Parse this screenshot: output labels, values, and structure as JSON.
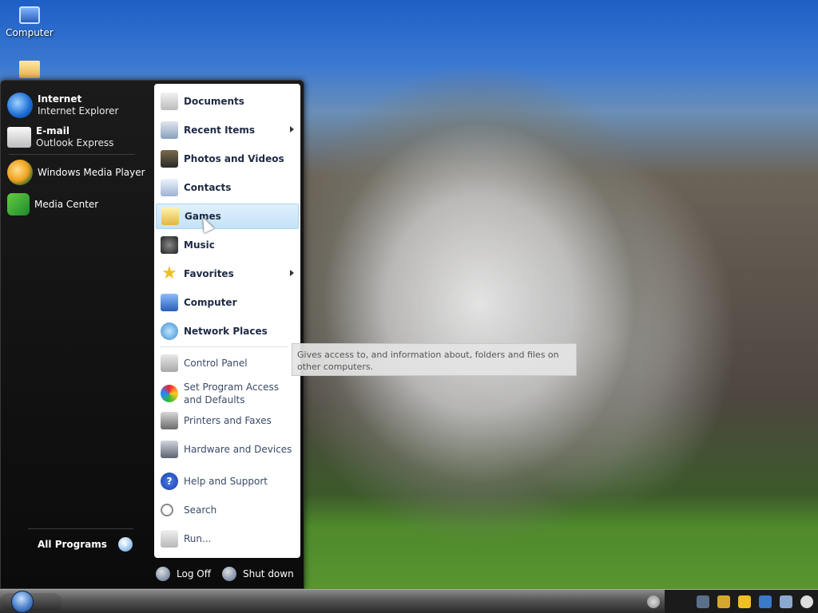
{
  "desktop": {
    "icons": [
      {
        "label": "Computer"
      }
    ]
  },
  "start_menu": {
    "pinned": [
      {
        "title": "Internet",
        "subtitle": "Internet Explorer"
      },
      {
        "title": "E-mail",
        "subtitle": "Outlook Express"
      }
    ],
    "recent": [
      {
        "label": "Windows Media Player"
      },
      {
        "label": "Media Center"
      }
    ],
    "all_programs": "All Programs",
    "right": [
      {
        "label": "Documents",
        "submenu": false
      },
      {
        "label": "Recent Items",
        "submenu": true
      },
      {
        "label": "Photos and Videos",
        "submenu": false
      },
      {
        "label": "Contacts",
        "submenu": false
      },
      {
        "label": "Games",
        "submenu": false,
        "hovered": true
      },
      {
        "label": "Music",
        "submenu": false
      },
      {
        "label": "Favorites",
        "submenu": true
      },
      {
        "label": "Computer",
        "submenu": false
      },
      {
        "label": "Network Places",
        "submenu": false
      }
    ],
    "right_lower": [
      {
        "label": "Control Panel"
      },
      {
        "label": "Set Program Access and Defaults"
      },
      {
        "label": "Printers and Faxes"
      },
      {
        "label": "Hardware and Devices"
      },
      {
        "label": "Help and Support"
      },
      {
        "label": "Search"
      },
      {
        "label": "Run..."
      }
    ],
    "footer": {
      "logoff": "Log Off",
      "shutdown": "Shut down"
    }
  },
  "tooltip": {
    "text": "Gives access to, and information about, folders and files on other computers."
  },
  "taskbar": {
    "tray_icons": [
      "search-icon",
      "bell-icon",
      "lightning-icon",
      "network-icon",
      "window-icon",
      "clock-icon"
    ]
  },
  "colors": {
    "menu_bg": "#0b0b0b",
    "right_pane_bg": "#ffffff",
    "hover": "#c4e2f7"
  }
}
